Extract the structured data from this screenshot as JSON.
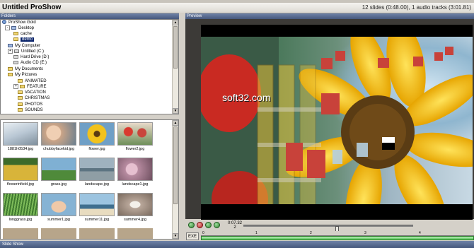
{
  "window": {
    "title": "Untitled ProShow",
    "status": "12 slides (0:48.00), 1 audio tracks (3:01.81)"
  },
  "folders_panel": {
    "header": "Folders",
    "tree": [
      {
        "label": "ProShow Gold",
        "icon": "root-icon"
      },
      {
        "label": "Desktop",
        "icon": "folder-icon"
      },
      {
        "label": "cache",
        "icon": "folder-icon"
      },
      {
        "label": "demo",
        "icon": "folder-icon",
        "selected": true
      },
      {
        "label": "My Computer",
        "icon": "computer-icon"
      },
      {
        "label": "Untitled (C:)",
        "icon": "drive-icon"
      },
      {
        "label": "Hard Drive (D:)",
        "icon": "drive-icon"
      },
      {
        "label": "Audio CD (E:)",
        "icon": "cd-icon"
      },
      {
        "label": "My Documents",
        "icon": "folder-icon"
      },
      {
        "label": "My Pictures",
        "icon": "folder-icon"
      },
      {
        "label": "ANIMATED",
        "icon": "folder-icon"
      },
      {
        "label": "FEATURE",
        "icon": "folder-icon"
      },
      {
        "label": "VACATION",
        "icon": "folder-icon"
      },
      {
        "label": "CHRISTMAS",
        "icon": "folder-icon"
      },
      {
        "label": "PHOTOS",
        "icon": "folder-icon"
      },
      {
        "label": "SOUNDS",
        "icon": "folder-icon"
      }
    ]
  },
  "files_panel": {
    "thumbnails": [
      {
        "name": "1881h0534.jpg",
        "bg": "#b9c7d4"
      },
      {
        "name": "chubbyfacekid.jpg",
        "bg": "#caa487"
      },
      {
        "name": "flower.jpg",
        "bg": "#e2b52a"
      },
      {
        "name": "flower2.jpg",
        "bg": "#c9453c"
      },
      {
        "name": "flowerinfield.jpg",
        "bg": "#d8b43a"
      },
      {
        "name": "grass.jpg",
        "bg": "#6e9bb4"
      },
      {
        "name": "landscape.jpg",
        "bg": "#7f98a7"
      },
      {
        "name": "landscape1.jpg",
        "bg": "#b78ba0"
      },
      {
        "name": "longgrass.jpg",
        "bg": "#5f9a4c"
      },
      {
        "name": "summer1.jpg",
        "bg": "#86b3d4"
      },
      {
        "name": "summer11.jpg",
        "bg": "#7ea6c0"
      },
      {
        "name": "summer4.jpg",
        "bg": "#b9a79a"
      }
    ]
  },
  "preview": {
    "header": "Preview",
    "watermark": "soft32.com"
  },
  "controls": {
    "time_top": "0:07.32",
    "time_bottom": "2",
    "exe_label": "EXE"
  },
  "timeline": {
    "ticks": [
      "0",
      "1",
      "2",
      "3",
      "4"
    ]
  },
  "slide_show": {
    "header": "Slide Show"
  }
}
